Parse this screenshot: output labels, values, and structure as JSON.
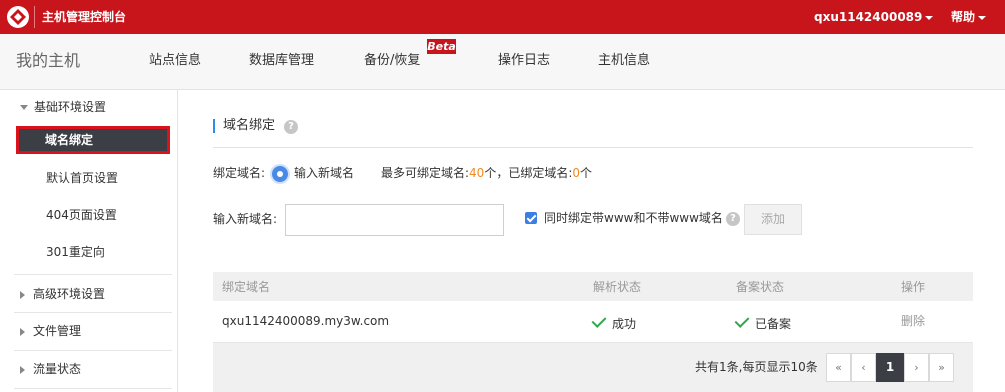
{
  "header": {
    "app_title": "主机管理控制台",
    "user": "qxu1142400089",
    "help": "帮助",
    "accent_color": "#c8141b"
  },
  "nav": {
    "brand": "我的主机",
    "items": [
      "站点信息",
      "数据库管理",
      "备份/恢复",
      "操作日志",
      "主机信息"
    ],
    "beta_badge": "Beta"
  },
  "sidebar": {
    "groups": [
      {
        "label": "基础环境设置",
        "expanded": true
      },
      {
        "label": "高级环境设置",
        "expanded": false
      },
      {
        "label": "文件管理",
        "expanded": false
      },
      {
        "label": "流量状态",
        "expanded": false
      }
    ],
    "sub_items": [
      "域名绑定",
      "默认首页设置",
      "404页面设置",
      "301重定向"
    ],
    "active_item": "域名绑定"
  },
  "main": {
    "section_title": "域名绑定",
    "bind_label": "绑定域名:",
    "radio_option": "输入新域名",
    "max_label": "最多可绑定域名:",
    "max_value": "40",
    "unit": "个",
    "bound_label": "，已绑定域名:",
    "bound_value": "0",
    "input_label": "输入新域名:",
    "input_value": "",
    "checkbox_label": "同时绑定带www和不带www域名",
    "checkbox_checked": true,
    "add_button": "添加"
  },
  "table": {
    "columns": [
      "绑定域名",
      "解析状态",
      "备案状态",
      "操作"
    ],
    "rows": [
      {
        "domain": "qxu1142400089.my3w.com",
        "dns_status": "成功",
        "icp_status": "已备案",
        "action": "删除"
      }
    ]
  },
  "pagination": {
    "summary": "共有1条,每页显示10条",
    "first": "«",
    "prev": "‹",
    "current": "1",
    "next": "›",
    "last": "»"
  }
}
